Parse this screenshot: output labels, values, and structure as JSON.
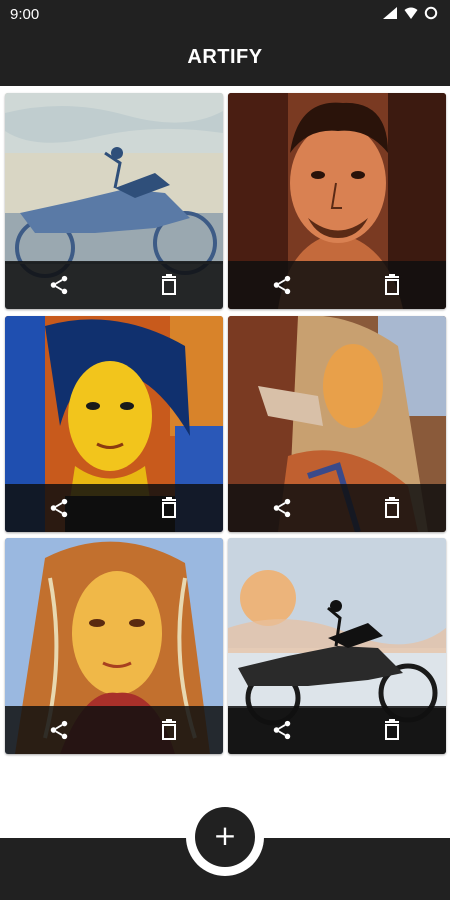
{
  "status_bar": {
    "time": "9:00",
    "icons": [
      "wifi-icon",
      "signal-icon",
      "battery-icon"
    ]
  },
  "app_bar": {
    "title": "ARTIFY"
  },
  "gallery": {
    "items": [
      {
        "subject": "motorcycle",
        "actions": [
          "share-icon",
          "delete-icon"
        ]
      },
      {
        "subject": "man-portrait",
        "actions": [
          "share-icon",
          "delete-icon"
        ]
      },
      {
        "subject": "woman-portrait-blue-yellow",
        "actions": [
          "share-icon",
          "delete-icon"
        ]
      },
      {
        "subject": "woman-pointing",
        "actions": [
          "share-icon",
          "delete-icon"
        ]
      },
      {
        "subject": "woman-portrait-long-hair",
        "actions": [
          "share-icon",
          "delete-icon"
        ]
      },
      {
        "subject": "motorcycle-sunset",
        "actions": [
          "share-icon",
          "delete-icon"
        ]
      }
    ]
  },
  "fab": {
    "label": "+",
    "icon": "add-icon"
  },
  "colors": {
    "app_bar": "#212121",
    "background": "#ffffff",
    "card_action_bar": "#0f0f0f"
  }
}
